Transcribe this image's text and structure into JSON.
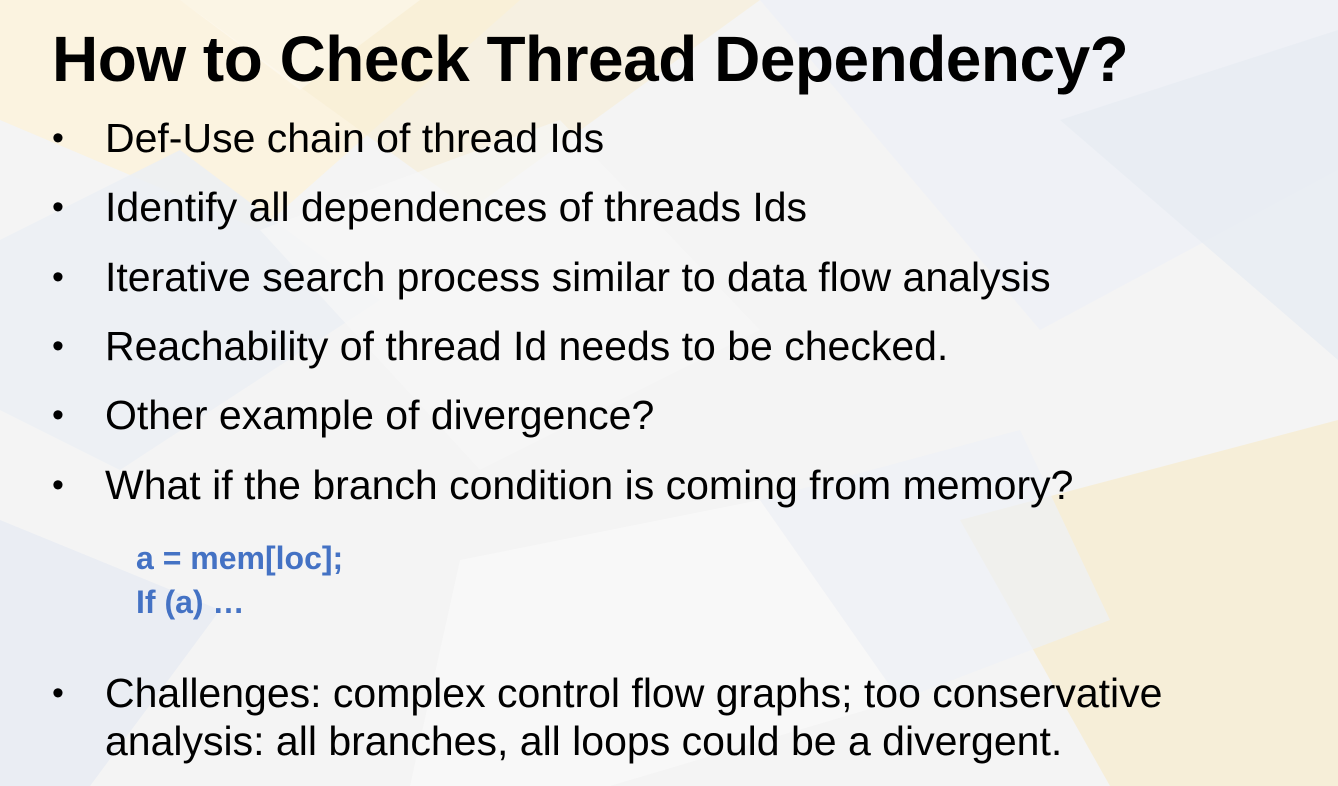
{
  "slide": {
    "title": "How to Check Thread Dependency?",
    "bullet_symbol": "•",
    "bullets": [
      "Def-Use chain of thread Ids",
      "Identify all dependences of threads Ids",
      "Iterative search process similar to data flow analysis",
      "Reachability of thread Id needs to be checked.",
      "Other example of divergence?",
      "What if the branch condition is coming from memory?"
    ],
    "code_lines": [
      "a = mem[loc];",
      "If (a) …"
    ],
    "final_bullet": "Challenges: complex control flow graphs; too conservative analysis: all branches, all loops could be a divergent."
  },
  "colors": {
    "code": "#4472c4",
    "text": "#000000"
  }
}
